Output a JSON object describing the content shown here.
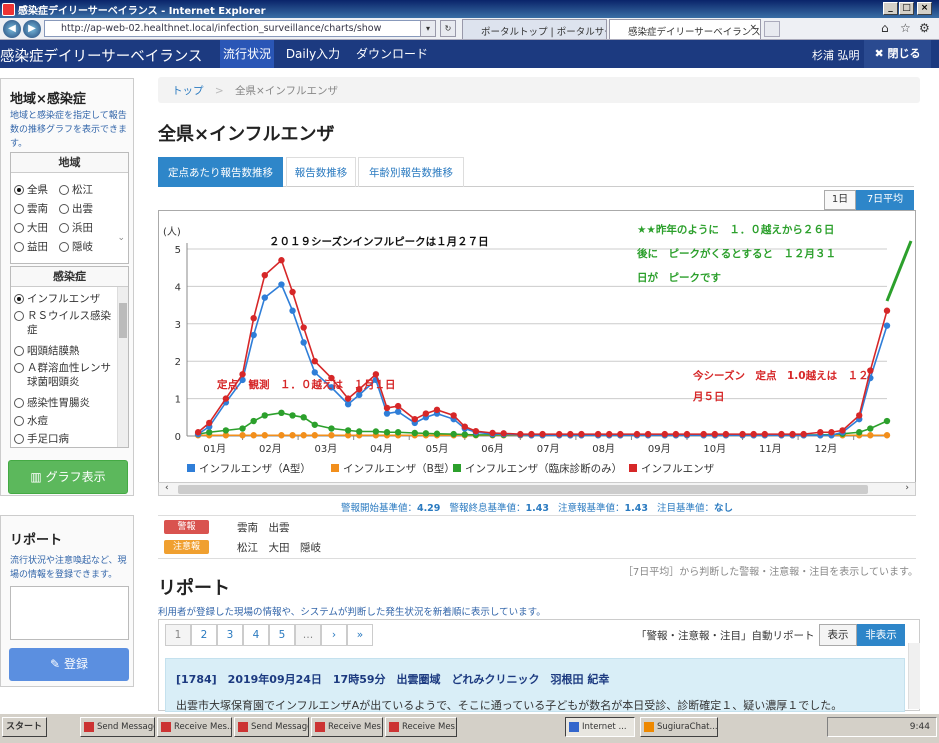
{
  "window": {
    "title": "感染症デイリーサーベイランス - Internet Explorer"
  },
  "ie": {
    "url": "http://ap-web-02.healthnet.local/infection_surveillance/charts/show",
    "tabs": [
      {
        "label": "ポータルトップ | ポータルサービス"
      },
      {
        "label": "感染症デイリーサーベイランス"
      }
    ]
  },
  "app": {
    "brand": "感染症デイリーサーベイランス",
    "nav": [
      "流行状況",
      "Daily入力",
      "ダウンロード"
    ],
    "user": "杉浦 弘明",
    "close": "閉じる"
  },
  "sidebar": {
    "title": "地域×感染症",
    "desc": "地域と感染症を指定して報告数の推移グラフを表示できます。",
    "region_header": "地域",
    "regions": [
      "全県",
      "松江",
      "雲南",
      "出雲",
      "大田",
      "浜田",
      "益田",
      "隠岐"
    ],
    "disease_header": "感染症",
    "diseases": [
      "インフルエンザ",
      "ＲＳウイルス感染症",
      "咽頭結膜熱",
      "Ａ群溶血性レンサ球菌咽頭炎",
      "感染性胃腸炎",
      "水痘",
      "手足口病"
    ],
    "graph_btn": "グラフ表示"
  },
  "report_panel": {
    "title": "リポート",
    "desc": "流行状況や注意喚起など、現場の情報を登録できます。",
    "register": "登録"
  },
  "breadcrumb": {
    "top": "トップ",
    "sep": ">",
    "current": "全県×インフルエンザ"
  },
  "page_title": "全県×インフルエンザ",
  "tabs": [
    "定点あたり報告数推移",
    "報告数推移",
    "年齢別報告数推移"
  ],
  "seg": [
    "1日",
    "7日平均"
  ],
  "chart_data": {
    "type": "line",
    "ylabel": "(人)",
    "ylim": [
      0,
      5
    ],
    "yticks": [
      "0",
      "1",
      "2",
      "3",
      "4",
      "5"
    ],
    "categories": [
      "01月",
      "02月",
      "03月",
      "04月",
      "05月",
      "06月",
      "07月",
      "08月",
      "09月",
      "10月",
      "11月",
      "12月"
    ],
    "x": [
      0.2,
      0.4,
      0.7,
      1.0,
      1.2,
      1.4,
      1.7,
      1.9,
      2.1,
      2.3,
      2.6,
      2.9,
      3.1,
      3.4,
      3.6,
      3.8,
      4.1,
      4.3,
      4.5,
      4.8,
      5.0,
      5.2,
      5.5,
      5.7,
      6.0,
      6.2,
      6.4,
      6.7,
      6.9,
      7.1,
      7.4,
      7.6,
      7.8,
      8.1,
      8.3,
      8.6,
      8.8,
      9.0,
      9.3,
      9.5,
      9.7,
      10.0,
      10.2,
      10.4,
      10.7,
      10.9,
      11.1,
      11.4,
      11.6,
      11.8,
      12.1,
      12.3,
      12.6
    ],
    "series": [
      {
        "name": "インフルエンザ（A型）",
        "color": "#2f7ed8",
        "values": [
          0.05,
          0.25,
          0.9,
          1.5,
          2.7,
          3.7,
          4.05,
          3.35,
          2.5,
          1.7,
          1.3,
          0.85,
          1.1,
          1.5,
          0.6,
          0.65,
          0.35,
          0.5,
          0.6,
          0.45,
          0.2,
          0.1,
          0.05,
          0.05,
          0.03,
          0.02,
          0.02,
          0.02,
          0.02,
          0.02,
          0.02,
          0.02,
          0.02,
          0.02,
          0.02,
          0.02,
          0.02,
          0.02,
          0.02,
          0.02,
          0.02,
          0.02,
          0.02,
          0.02,
          0.02,
          0.02,
          0.02,
          0.02,
          0.02,
          0.1,
          0.45,
          1.55,
          2.95
        ]
      },
      {
        "name": "インフルエンザ（B型）",
        "color": "#f28f1c",
        "values": [
          0.02,
          0.02,
          0.02,
          0.02,
          0.02,
          0.02,
          0.02,
          0.02,
          0.02,
          0.02,
          0.02,
          0.02,
          0.02,
          0.02,
          0.02,
          0.02,
          0.02,
          0.02,
          0.02,
          0.02,
          0.02,
          0.02,
          0.02,
          0.02,
          0.02,
          0.02,
          0.02,
          0.02,
          0.02,
          0.02,
          0.02,
          0.02,
          0.02,
          0.02,
          0.02,
          0.02,
          0.02,
          0.02,
          0.02,
          0.02,
          0.02,
          0.02,
          0.02,
          0.02,
          0.02,
          0.02,
          0.02,
          0.02,
          0.02,
          0.02,
          0.02,
          0.02,
          0.02
        ]
      },
      {
        "name": "インフルエンザ（臨床診断のみ）",
        "color": "#2ca02c",
        "values": [
          0.05,
          0.1,
          0.15,
          0.2,
          0.4,
          0.55,
          0.62,
          0.55,
          0.5,
          0.3,
          0.2,
          0.15,
          0.12,
          0.12,
          0.1,
          0.1,
          0.08,
          0.07,
          0.06,
          0.05,
          0.04,
          0.03,
          0.03,
          0.03,
          0.03,
          0.03,
          0.03,
          0.03,
          0.03,
          0.03,
          0.03,
          0.03,
          0.03,
          0.03,
          0.03,
          0.03,
          0.03,
          0.03,
          0.03,
          0.03,
          0.03,
          0.03,
          0.03,
          0.03,
          0.03,
          0.03,
          0.03,
          0.03,
          0.04,
          0.06,
          0.1,
          0.2,
          0.4
        ]
      },
      {
        "name": "インフルエンザ",
        "color": "#d62728",
        "values": [
          0.1,
          0.35,
          1.0,
          1.65,
          3.15,
          4.3,
          4.7,
          3.85,
          2.9,
          2.0,
          1.55,
          1.0,
          1.25,
          1.65,
          0.75,
          0.8,
          0.45,
          0.6,
          0.7,
          0.55,
          0.25,
          0.13,
          0.08,
          0.07,
          0.05,
          0.05,
          0.05,
          0.05,
          0.05,
          0.05,
          0.05,
          0.05,
          0.05,
          0.05,
          0.05,
          0.05,
          0.05,
          0.05,
          0.05,
          0.05,
          0.05,
          0.05,
          0.05,
          0.05,
          0.05,
          0.05,
          0.05,
          0.1,
          0.1,
          0.15,
          0.55,
          1.75,
          3.35
        ]
      }
    ],
    "annotations": {
      "peak": "２０１９シーズンインフルピークは１月２７日",
      "red1": "定点　観測　１．０越えは　１月１日",
      "green": [
        "★★昨年のように　１．０越えから２６日",
        "後に　ピークがくるとすると　１２月３１",
        "日が　ピークです"
      ],
      "red2": [
        "今シーズン　定点　1.0越えは　１２",
        "月５日"
      ]
    }
  },
  "thresholds": {
    "t1": "警報開始基準値：",
    "v1": "4.29",
    "t2": "警報終息基準値：",
    "v2": "1.43",
    "t3": "注意報基準値：",
    "v3": "1.43",
    "t4": "注目基準値：",
    "v4": "なし"
  },
  "levels": {
    "alarm": "警報",
    "alarm_areas": "雲南　出雲",
    "warn": "注意報",
    "warn_areas": "松江　大田　隠岐",
    "alarm_color": "#d9534f",
    "warn_color": "#f0a030"
  },
  "level_note": "［7日平均］から判断した警報・注意報・注目を表示しています。",
  "reports": {
    "title": "リポート",
    "desc": "利用者が登録した現場の情報や、システムが判断した発生状況を新着順に表示しています。",
    "pages": [
      "1",
      "2",
      "3",
      "4",
      "5",
      "…",
      "›",
      "»"
    ],
    "auto_label": "「警報・注意報・注目」自動リポート",
    "show": "表示",
    "hide": "非表示",
    "item_title": "[1784]　2019年09月24日　17時59分　出雲圏域　どれみクリニック　羽根田 紀幸",
    "item_body": "出雲市大塚保育園でインフルエンザAが出ているようで、そこに通っている子どもが数名が本日受診、診断確定１、疑い濃厚１でした。"
  },
  "taskbar": {
    "start": "スタート",
    "items": [
      "Send Message",
      "Receive Mes...",
      "Send Message",
      "Receive Mes...",
      "Receive Mes...",
      "Internet ...",
      "SugiuraChat..."
    ],
    "clock": "9:44"
  }
}
